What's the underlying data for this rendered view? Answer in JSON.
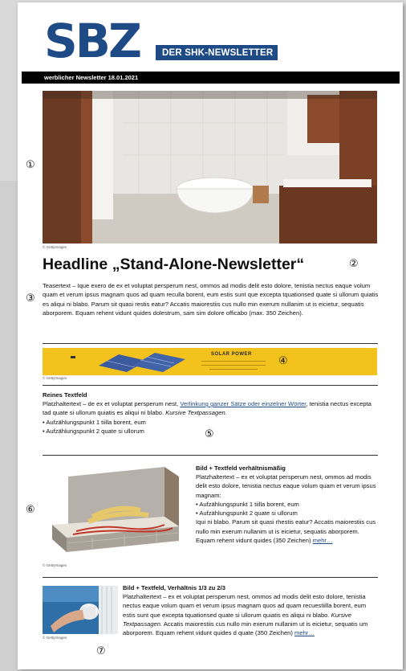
{
  "brand": {
    "logo": "SBZ",
    "tagline": "DER SHK-NEWSLETTER",
    "color": "#1e4a86"
  },
  "date_bar": "werblicher Newsletter 18.01.2021",
  "markers": [
    "①",
    "②",
    "③",
    "④",
    "⑤",
    "⑥",
    "⑦"
  ],
  "hero": {
    "credit": "© GettyImages"
  },
  "headline": "Headline „Stand-Alone-Newsletter“",
  "teaser": "Teasertext – Ique exero de ex et voluptat persperum nest, ommos ad modis delit esto dolore, tenistia nectus eaque volum quam et verum ipsus magnam quos ad quam reculla borent, eum estis sunt que excepta tquationsed quate si ullorum quiatis es aliqui ni blabo. Parum sit quasi restis eatur? Accatis maiorestiis cus nullo min exerum nullanim ut is eicietur, sequatis aborporem. Equam rehent vidunt quides dolestrum, sam sim dolore officabo (max. 350 Zeichen).",
  "banner": {
    "title": "SOLAR POWER",
    "credit": "© GettyImages",
    "color": "#f4c21d"
  },
  "text_section": {
    "title": "Reines Textfeld",
    "body_start": "Platzhaltertext – de ex et voluptat persperum nest, ",
    "link": "Verlinkung ganzer Sätze oder einzelner Wörter",
    "body_mid": ", tenistia nectus excepta tad quate si ullorum quiatis es aliqui ni blabo. ",
    "body_italic": "Kursive Textpassagen.",
    "bullets": [
      "• Aufzählungspunkt 1 tiilla borent, eum",
      "• Aufzählungspunkt 2 quate si ullorum"
    ]
  },
  "image_text_section": {
    "title": "Bild + Textfeld verhältnismäßig",
    "body_start": "Platzhaltertext – ex et voluptat persperum nest, ommos ad modis delit esto dolore, tenistia nectus eaque volum quam et verum ipsus magnam:",
    "bullets": [
      "• Aufzählungspunkt 1 tiilla borent, eum",
      "• Aufzählungspunkt 2 quate si ullorum"
    ],
    "body_end": "Iqui ni blabo. Parum sit quasi rhestis eatur? Accatis maiorestiis cus nullo min exerum nullanim ut is eicietur, sequatis aborporem. Equam rehent vidunt quides (350 Zeichen) ",
    "link": "mehr…",
    "credit": "© GettyImages"
  },
  "third_section": {
    "title": "Bild + Textfeld, Verhältnis 1/3 zu 2/3",
    "body_start": "Platzhaltertext – ex et voluptat persperum nest, ommos ad modis delit esto dolore, tenistia nectus eaque volum quam et verum ipsus magnam quos ad quam recuestiilla borent, eum estis sunt que excepta tquationsed quate si ullorum quiatis es aliqui ni blabo. ",
    "body_italic": "Kursive Textpassagen.",
    "body_end": " Accatis maiorestiis cus nullo min exerum nullanim ut is eicietur, sequatis um aborporem. Equam rehent vidunt quides d quate (350 Zeichen) ",
    "link": "mehr…",
    "credit": "© GettyImages"
  }
}
